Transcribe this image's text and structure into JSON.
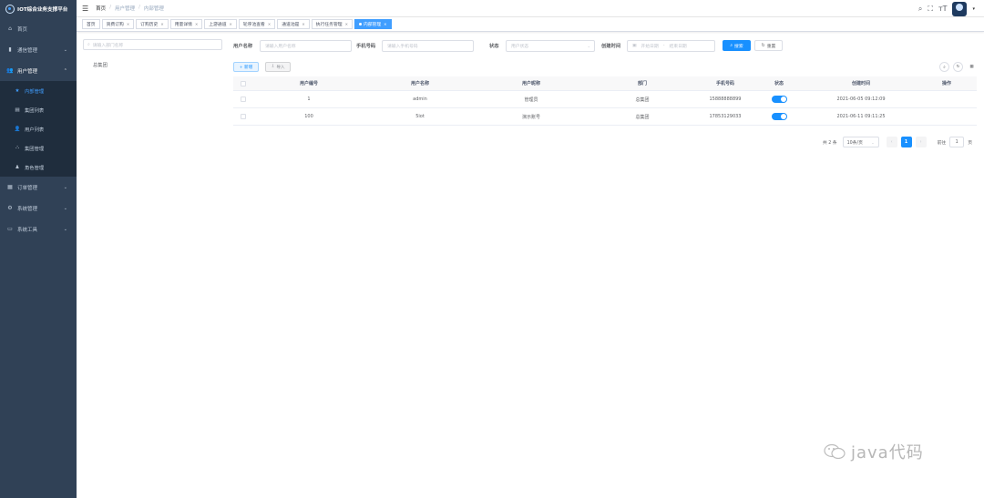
{
  "app": {
    "title": "IOT综合业务支撑平台"
  },
  "sidebar": {
    "items": [
      {
        "label": "首页",
        "icon": "home-icon"
      },
      {
        "label": "通信管理",
        "icon": "sim-icon",
        "has_children": true
      },
      {
        "label": "用户管理",
        "icon": "users-icon",
        "has_children": true,
        "open": true,
        "children": [
          {
            "label": "内部管理",
            "icon": "star-icon",
            "active": true
          },
          {
            "label": "集团列表",
            "icon": "book-icon"
          },
          {
            "label": "用户列表",
            "icon": "user-icon"
          },
          {
            "label": "集团管理",
            "icon": "org-icon"
          },
          {
            "label": "角色管理",
            "icon": "role-icon"
          }
        ]
      },
      {
        "label": "订单管理",
        "icon": "order-icon",
        "has_children": true
      },
      {
        "label": "系统管理",
        "icon": "gear-icon",
        "has_children": true
      },
      {
        "label": "系统工具",
        "icon": "tool-icon",
        "has_children": true
      }
    ]
  },
  "breadcrumb": [
    "首页",
    "用户管理",
    "内部管理"
  ],
  "tags": [
    "首页",
    "资费订购",
    "订购历史",
    "用量详情",
    "上游通道",
    "轮序池查看",
    "通道池是",
    "执行任务管理",
    "内部管理"
  ],
  "dept_tree": {
    "search_placeholder": "请输入部门名称",
    "root": "总集团"
  },
  "filters": {
    "username_label": "用户名称",
    "username_placeholder": "请输入用户名称",
    "phone_label": "手机号码",
    "phone_placeholder": "请输入手机号码",
    "status_label": "状态",
    "status_placeholder": "用户状态",
    "created_label": "创建时间",
    "start_placeholder": "开始日期",
    "range_sep": "-",
    "end_placeholder": "结束日期",
    "search_button": "搜索",
    "reset_button": "重置"
  },
  "toolbar": {
    "add_label": "+ 新增",
    "import_label": "导入"
  },
  "table": {
    "columns": [
      "用户编号",
      "用户名称",
      "用户昵称",
      "部门",
      "手机号码",
      "状态",
      "创建时间",
      "操作"
    ],
    "rows": [
      {
        "id": "1",
        "username": "admin",
        "nickname": "管理员",
        "dept": "总集团",
        "phone": "15888888899",
        "enabled": true,
        "created": "2021-06-05 09:12:09"
      },
      {
        "id": "100",
        "username": "5iot",
        "nickname": "演示账号",
        "dept": "总集团",
        "phone": "17853129033",
        "enabled": true,
        "created": "2021-06-11 09:11:25"
      }
    ]
  },
  "pagination": {
    "total_text": "共 2 条",
    "page_size": "10条/页",
    "current_page": "1",
    "goto_label": "前往",
    "goto_value": "1",
    "page_unit": "页"
  },
  "watermark": "java代码",
  "colors": {
    "primary": "#1890ff",
    "sidebar_bg": "#304156",
    "submenu_bg": "#1f2d3d"
  }
}
